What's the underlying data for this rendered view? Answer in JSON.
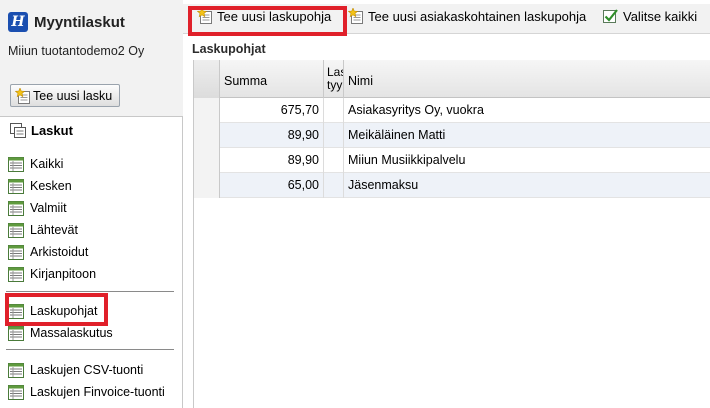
{
  "app": {
    "title": "Myyntilaskut",
    "logo_letter": "H",
    "company": "Miiun tuotantodemo2 Oy"
  },
  "sidebar": {
    "new_invoice_label": "Tee uusi lasku",
    "section_title": "Laskut",
    "group1": [
      {
        "label": "Kaikki"
      },
      {
        "label": "Kesken"
      },
      {
        "label": "Valmiit"
      },
      {
        "label": "Lähtevät"
      },
      {
        "label": "Arkistoidut"
      },
      {
        "label": "Kirjanpitoon"
      }
    ],
    "group2": [
      {
        "label": "Laskupohjat"
      },
      {
        "label": "Massalaskutus"
      }
    ],
    "group3": [
      {
        "label": "Laskujen CSV-tuonti"
      },
      {
        "label": "Laskujen Finvoice-tuonti"
      }
    ]
  },
  "toolbar": {
    "new_template_label": "Tee uusi laskupohja",
    "new_customer_template_label": "Tee uusi asiakaskohtainen laskupohja",
    "select_all_label": "Valitse kaikki"
  },
  "main": {
    "title": "Laskupohjat",
    "columns": {
      "sum": "Summa",
      "type": "Lasku tyyppi",
      "name": "Nimi"
    },
    "rows": [
      {
        "sum": "675,70",
        "name": "Asiakasyritys Oy, vuokra"
      },
      {
        "sum": "89,90",
        "name": "Meikäläinen Matti"
      },
      {
        "sum": "89,90",
        "name": "Miiun Musiikkipalvelu"
      },
      {
        "sum": "65,00",
        "name": "Jäsenmaksu"
      }
    ]
  },
  "colors": {
    "highlight": "#e0202a",
    "logo": "#1b4fb0",
    "row_alt": "#eef2f8"
  }
}
